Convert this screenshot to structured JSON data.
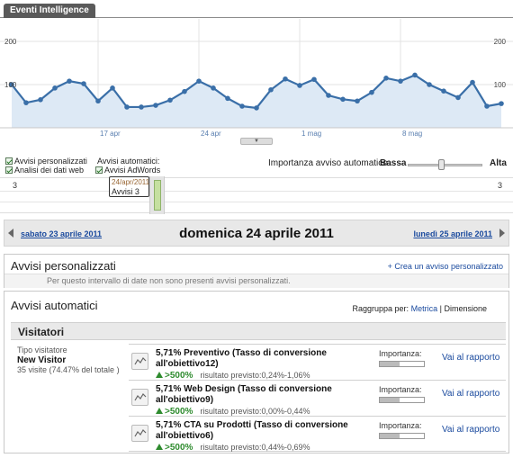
{
  "tab": {
    "label": "Eventi Intelligence"
  },
  "chart_data": {
    "type": "area",
    "x": [
      "2011-04-11",
      "2011-04-12",
      "2011-04-13",
      "2011-04-14",
      "2011-04-15",
      "2011-04-16",
      "2011-04-17",
      "2011-04-18",
      "2011-04-19",
      "2011-04-20",
      "2011-04-21",
      "2011-04-22",
      "2011-04-23",
      "2011-04-24",
      "2011-04-25",
      "2011-04-26",
      "2011-04-27",
      "2011-04-28",
      "2011-04-29",
      "2011-04-30",
      "2011-05-01",
      "2011-05-02",
      "2011-05-03",
      "2011-05-04",
      "2011-05-05",
      "2011-05-06",
      "2011-05-07",
      "2011-05-08",
      "2011-05-09",
      "2011-05-10",
      "2011-05-11",
      "2011-05-12",
      "2011-05-13",
      "2011-05-14",
      "2011-05-15"
    ],
    "values": [
      100,
      58,
      65,
      92,
      108,
      102,
      62,
      92,
      48,
      48,
      52,
      64,
      84,
      108,
      92,
      68,
      50,
      46,
      88,
      113,
      98,
      112,
      75,
      66,
      62,
      82,
      115,
      108,
      122,
      100,
      85,
      70,
      105,
      50,
      56
    ],
    "y_axis_left": {
      "ticks": [
        "200",
        "100"
      ],
      "range": [
        0,
        200
      ]
    },
    "y_axis_right": {
      "ticks": [
        "200",
        "100"
      ],
      "range": [
        0,
        200
      ]
    },
    "x_tick_labels": [
      {
        "label": "17 apr",
        "x": "2011-04-17"
      },
      {
        "label": "24 apr",
        "x": "2011-04-24"
      },
      {
        "label": "1 mag",
        "x": "2011-05-01"
      },
      {
        "label": "8 mag",
        "x": "2011-05-08"
      }
    ],
    "line_color": "#3a6fa8",
    "fill_color": "#dde9f5",
    "grid": true
  },
  "legend": {
    "custom_alerts": "Avvisi personalizzati",
    "web_data": "Analisi dei dati web",
    "auto_alerts": "Avvisi automatici:",
    "adwords": "Avvisi AdWords"
  },
  "importance": {
    "label": "Importanza avviso automatico:",
    "low": "Bassa",
    "high": "Alta",
    "level": 0.42
  },
  "strip": {
    "left_count": "3",
    "right_count": "3"
  },
  "tooltip": {
    "date": "24/apr/2011",
    "value": "Avvisi 3"
  },
  "nav": {
    "prev": "sabato 23 aprile 2011",
    "current": "domenica 24 aprile 2011",
    "next": "lunedì 25 aprile 2011"
  },
  "custom_panel": {
    "title": "Avvisi personalizzati",
    "create_link": "+ Crea un avviso personalizzato",
    "empty_text": "Per questo intervallo di date non sono presenti avvisi personalizzati."
  },
  "auto_panel": {
    "title": "Avvisi automatici",
    "group_by_label": "Raggruppa per:",
    "group_metric": "Metrica",
    "group_separator": "|",
    "group_dimension": "Dimensione",
    "section": "Visitatori",
    "segment": {
      "label": "Tipo visitatore",
      "value": "New Visitor",
      "sub": "35 visite (74.47% del totale )"
    },
    "alerts": [
      {
        "metric": "5,71%  Preventivo (Tasso di conversione all'obiettivo12)",
        "change": ">500%",
        "expected": "risultato previsto:0,24%-1,06%",
        "importance_label": "Importanza:",
        "importance": 0.45,
        "link": "Vai al rapporto"
      },
      {
        "metric": "5,71%  Web Design (Tasso di conversione all'obiettivo9)",
        "change": ">500%",
        "expected": "risultato previsto:0,00%-0,44%",
        "importance_label": "Importanza:",
        "importance": 0.45,
        "link": "Vai al rapporto"
      },
      {
        "metric": "5,71%  CTA su Prodotti (Tasso di conversione all'obiettivo6)",
        "change": ">500%",
        "expected": "risultato previsto:0,44%-0,69%",
        "importance_label": "Importanza:",
        "importance": 0.45,
        "link": "Vai al rapporto"
      }
    ]
  }
}
